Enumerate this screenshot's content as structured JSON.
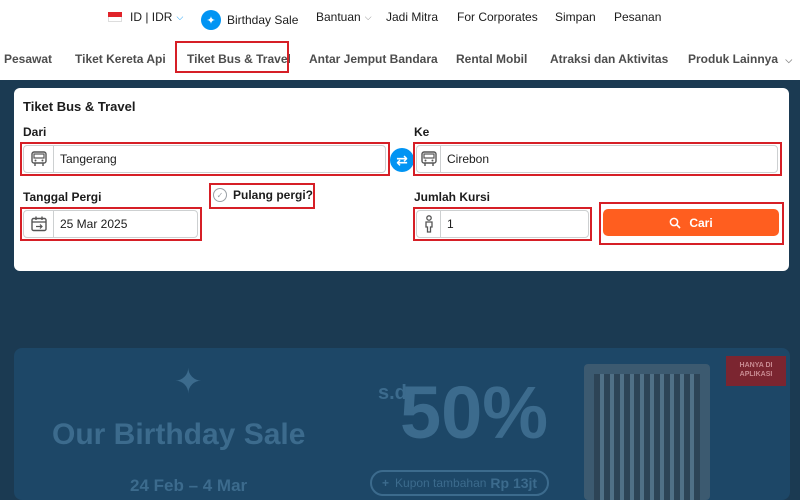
{
  "topbar": {
    "locale": "ID | IDR",
    "birthday_sale": "Birthday Sale",
    "bantuan": "Bantuan",
    "jadi_mitra": "Jadi Mitra",
    "for_corporates": "For Corporates",
    "simpan": "Simpan",
    "pesanan": "Pesanan"
  },
  "nav": {
    "items": [
      {
        "label": "Pesawat"
      },
      {
        "label": "Tiket Kereta Api"
      },
      {
        "label": "Tiket Bus & Travel"
      },
      {
        "label": "Antar Jemput Bandara"
      },
      {
        "label": "Rental Mobil"
      },
      {
        "label": "Atraksi dan Aktivitas"
      },
      {
        "label": "Produk Lainnya"
      }
    ],
    "active_index": 2
  },
  "form": {
    "title": "Tiket Bus & Travel",
    "from_label": "Dari",
    "from_value": "Tangerang",
    "to_label": "Ke",
    "to_value": "Cirebon",
    "date_label": "Tanggal Pergi",
    "date_value": "25 Mar 2025",
    "round_trip_label": "Pulang pergi?",
    "round_trip_checked": false,
    "seats_label": "Jumlah Kursi",
    "seats_value": "1",
    "search_label": "Cari"
  },
  "banner": {
    "title": "Our Birthday Sale",
    "sd": "s.d.",
    "discount": "50%",
    "dates": "24 Feb – 4 Mar",
    "kupon_text": "Kupon tambahan",
    "kupon_amount": "Rp 13jt",
    "badge": "HANYA DI APLIKASI"
  },
  "colors": {
    "accent_blue": "#0194f3",
    "search_orange": "#ff5e1f",
    "highlight_red": "#d61f26",
    "backdrop": "#1b3a52"
  }
}
